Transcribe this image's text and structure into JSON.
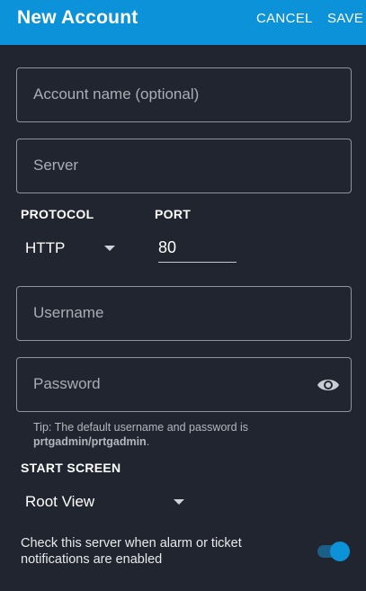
{
  "header": {
    "title": "New Account",
    "cancel_label": "CANCEL",
    "save_label": "SAVE"
  },
  "form": {
    "account_name_placeholder": "Account name (optional)",
    "server_placeholder": "Server",
    "protocol_label": "PROTOCOL",
    "protocol_value": "HTTP",
    "port_label": "PORT",
    "port_value": "80",
    "username_placeholder": "Username",
    "password_placeholder": "Password",
    "tip_prefix": "Tip: The default username and password is",
    "tip_credentials": "prtgadmin/prtgadmin",
    "tip_suffix": ".",
    "start_screen_label": "START SCREEN",
    "start_screen_value": "Root View",
    "notifications_text": "Check this server when alarm or ticket notifications are enabled",
    "notifications_enabled": true
  },
  "colors": {
    "accent": "#0b92d8",
    "background": "#212530"
  },
  "icons": {
    "password_visibility": "eye-icon",
    "dropdown": "caret-down-icon"
  }
}
